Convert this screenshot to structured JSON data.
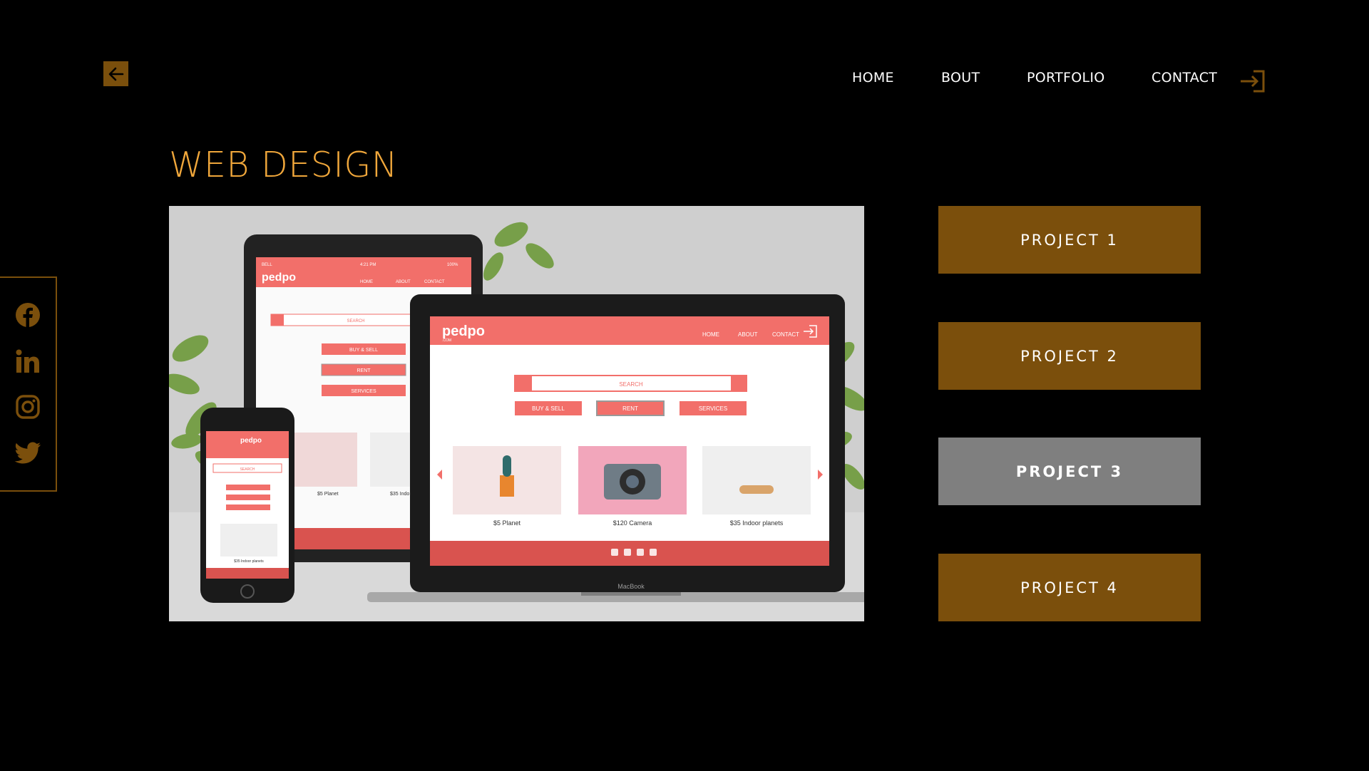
{
  "colors": {
    "accent": "#f0a73b",
    "brand_brown": "#7b4f0c",
    "active_grey": "#7f7f7f",
    "mock_coral": "#f26f6a"
  },
  "header": {
    "back_icon": "arrow-left-icon",
    "nav": [
      {
        "label": "HOME"
      },
      {
        "label": "BOUT"
      },
      {
        "label": "PORTFOLIO"
      },
      {
        "label": "CONTACT"
      }
    ],
    "login_icon": "sign-in-icon"
  },
  "page_title": "WEB DESIGN",
  "social": [
    {
      "icon": "facebook-icon"
    },
    {
      "icon": "linkedin-icon"
    },
    {
      "icon": "instagram-icon"
    },
    {
      "icon": "twitter-icon"
    }
  ],
  "projects": [
    {
      "label": "PROJECT 1",
      "active": false
    },
    {
      "label": "PROJECT 2",
      "active": false
    },
    {
      "label": "PROJECT 3",
      "active": true
    },
    {
      "label": "PROJECT 4",
      "active": false
    }
  ],
  "mockup": {
    "brand": "pedpo",
    "brand_sub": ".COM",
    "nav": [
      "HOME",
      "ABOUT",
      "CONTACT"
    ],
    "search_placeholder": "SEARCH",
    "buttons": [
      "BUY & SELL",
      "RENT",
      "SERVICES"
    ],
    "products": [
      {
        "caption": "$5 Planet"
      },
      {
        "caption": "$120 Camera"
      },
      {
        "caption": "$35 Indoor planets"
      }
    ],
    "laptop_label": "MacBook",
    "phone_caption": "$35 Indoor planets",
    "tablet_status_carrier": "BELL",
    "tablet_status_time": "4:21 PM",
    "tablet_status_battery": "100%",
    "tablet_captions": [
      "$5 Planet",
      "$35 Indo"
    ]
  }
}
